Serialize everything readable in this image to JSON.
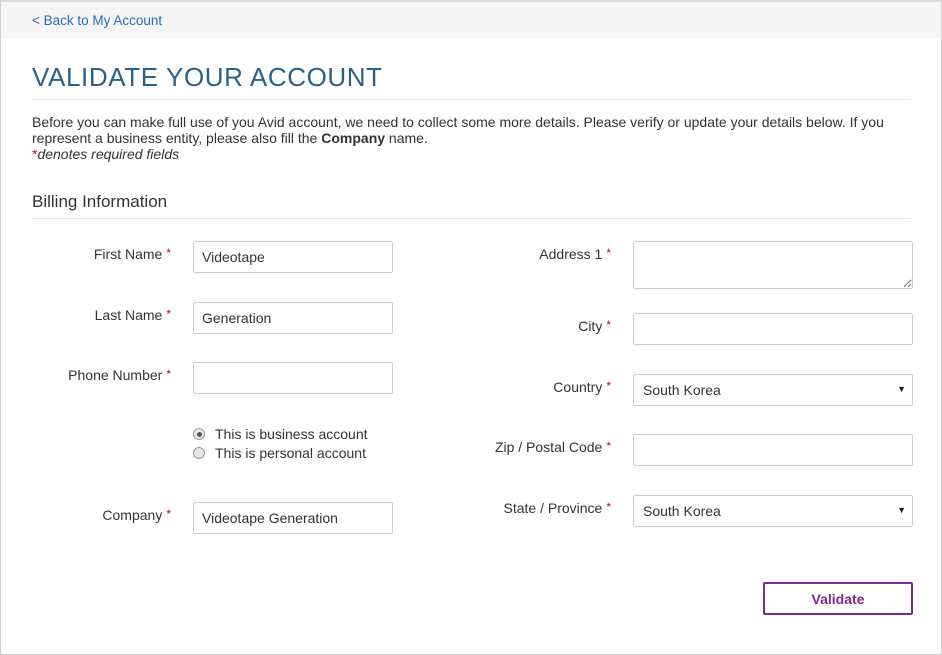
{
  "topbar": {
    "back_link": "< Back to My Account"
  },
  "page": {
    "title": "VALIDATE YOUR ACCOUNT",
    "intro_part1": "Before you can make full use of you Avid account, we need to collect some more details. Please verify or update your details below. If you represent a business entity, please also fill the ",
    "intro_bold": "Company",
    "intro_part2": " name.",
    "required_star": "*",
    "required_note": "denotes required fields"
  },
  "section": {
    "title": "Billing Information"
  },
  "form": {
    "first_name": {
      "label": "First Name",
      "value": "Videotape"
    },
    "last_name": {
      "label": "Last Name",
      "value": "Generation"
    },
    "phone": {
      "label": "Phone Number",
      "value": ""
    },
    "account_type": {
      "options": [
        "This is business account",
        "This is personal account"
      ],
      "selected_index": 0
    },
    "company": {
      "label": "Company",
      "value": "Videotape Generation"
    },
    "address1": {
      "label": "Address 1",
      "value": ""
    },
    "city": {
      "label": "City",
      "value": ""
    },
    "country": {
      "label": "Country",
      "value": "South Korea"
    },
    "zip": {
      "label": "Zip / Postal Code",
      "value": ""
    },
    "state": {
      "label": "State / Province",
      "value": "South Korea"
    },
    "submit_label": "Validate"
  },
  "icons": {
    "select_arrow": "triangle-down-icon"
  },
  "colors": {
    "accent": "#7b2a8f",
    "title": "#2c5f8a",
    "link": "#2a6bbf",
    "required": "#d0021b"
  }
}
